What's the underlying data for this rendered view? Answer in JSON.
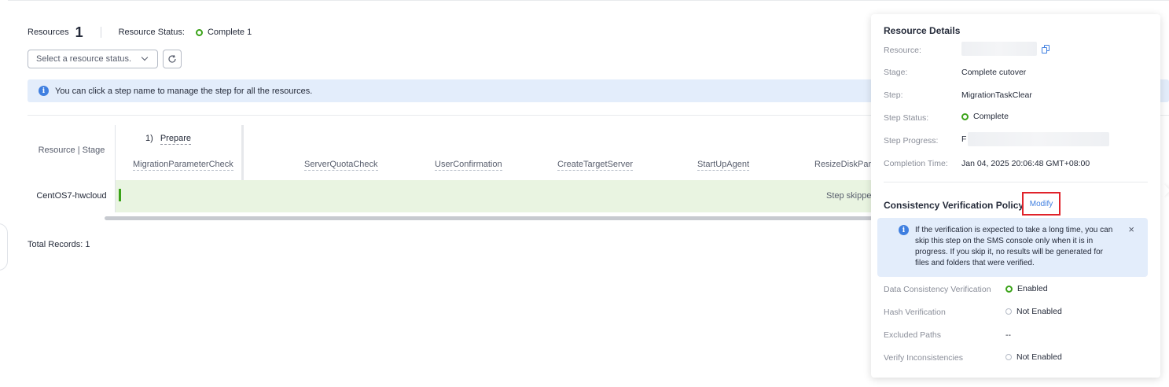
{
  "summary": {
    "resources_label": "Resources",
    "resources_count": "1",
    "status_label": "Resource Status:",
    "status_value": "Complete 1"
  },
  "filter": {
    "select_placeholder": "Select a resource status."
  },
  "banner": {
    "text": "You can click a step name to manage the step for all the resources."
  },
  "grid": {
    "resource_header": "Resource | Stage",
    "stage": {
      "number": "1)",
      "name": "Prepare"
    },
    "steps": [
      "MigrationParameterCheck",
      "ServerQuotaCheck",
      "UserConfirmation",
      "CreateTargetServer",
      "StartUpAgent",
      "ResizeDiskPartit"
    ],
    "rows": [
      {
        "resource": "CentOS7-hwcloud",
        "note": "Step skipped"
      }
    ],
    "total": "Total Records: 1"
  },
  "details": {
    "title": "Resource Details",
    "fields": [
      {
        "label": "Resource:",
        "value": ""
      },
      {
        "label": "Stage:",
        "value": "Complete cutover"
      },
      {
        "label": "Step:",
        "value": "MigrationTaskClear"
      },
      {
        "label": "Step Status:",
        "value": "Complete"
      },
      {
        "label": "Step Progress:",
        "value": "F"
      },
      {
        "label": "Completion Time:",
        "value": "Jan 04, 2025 20:06:48 GMT+08:00"
      }
    ],
    "colors": {
      "complete": "#3ba319",
      "link": "#3f7fe0",
      "highlight": "#e0232b"
    }
  },
  "policy": {
    "title": "Consistency Verification Policy",
    "modify_label": "Modify",
    "alert": "If the verification is expected to take a long time, you can skip this step on the SMS console only when it is in progress. If you skip it, no results will be generated for files and folders that were verified.",
    "close_icon": "×",
    "items": [
      {
        "label": "Data Consistency Verification",
        "value": "Enabled"
      },
      {
        "label": "Hash Verification",
        "value": "Not Enabled"
      },
      {
        "label": "Excluded Paths",
        "value": "--"
      },
      {
        "label": "Verify Inconsistencies",
        "value": "Not Enabled"
      }
    ]
  }
}
